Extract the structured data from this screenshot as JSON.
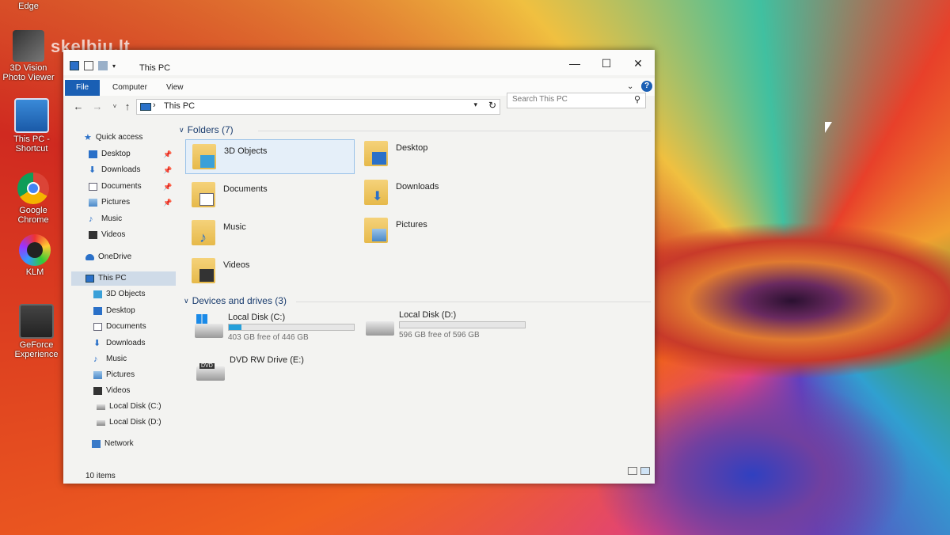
{
  "watermark": "skelbiu.lt",
  "desktop": {
    "icons": [
      {
        "label": "Edge"
      },
      {
        "label": "3D Vision Photo Viewer"
      },
      {
        "label": "This PC - Shortcut"
      },
      {
        "label": "Google Chrome"
      },
      {
        "label": "KLM"
      },
      {
        "label": "GeForce Experience"
      }
    ]
  },
  "window": {
    "title": "This PC",
    "controls": {
      "minimize": "—",
      "maximize": "☐",
      "close": "✕"
    },
    "ribbon_tabs": [
      "File",
      "Computer",
      "View"
    ],
    "help": "?",
    "address": {
      "crumb": "This PC",
      "chevron": "›"
    },
    "search": {
      "placeholder": "Search This PC"
    },
    "nav": {
      "quick_access": "Quick access",
      "qa_items": [
        "Desktop",
        "Downloads",
        "Documents",
        "Pictures",
        "Music",
        "Videos"
      ],
      "onedrive": "OneDrive",
      "this_pc": "This PC",
      "pc_items": [
        "3D Objects",
        "Desktop",
        "Documents",
        "Downloads",
        "Music",
        "Pictures",
        "Videos",
        "Local Disk (C:)",
        "Local Disk (D:)"
      ],
      "network": "Network"
    },
    "folders_header": "Folders (7)",
    "folders": [
      "3D Objects",
      "Desktop",
      "Documents",
      "Downloads",
      "Music",
      "Pictures",
      "Videos"
    ],
    "drives_header": "Devices and drives (3)",
    "drives": [
      {
        "name": "Local Disk (C:)",
        "free": "403 GB free of 446 GB",
        "used_fraction": 0.1
      },
      {
        "name": "Local Disk (D:)",
        "free": "596 GB free of 596 GB",
        "used_fraction": 0.0
      },
      {
        "name": "DVD RW Drive (E:)"
      }
    ],
    "dvd_label": "DVD",
    "status": "10 items",
    "colors": {
      "accent": "#1a5fb4",
      "drive_fill": "#26a0da",
      "selection": "#cfdbe8"
    }
  }
}
